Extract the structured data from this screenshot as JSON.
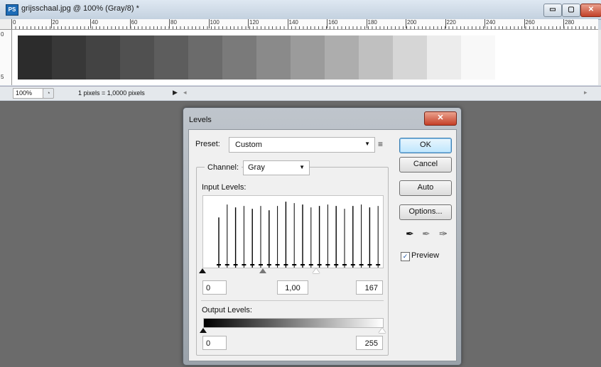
{
  "document": {
    "app_icon": "PS",
    "title": "grijsschaal.jpg @ 100% (Gray/8) *",
    "window_buttons": {
      "minimize": "▭",
      "maximize": "▢",
      "close": "✕"
    },
    "ruler_h_labels": [
      "0",
      "20",
      "40",
      "60",
      "80",
      "100",
      "120",
      "140",
      "160",
      "180",
      "200",
      "220",
      "240",
      "260",
      "280"
    ],
    "ruler_v_labels": [
      "0",
      "5"
    ],
    "swatch_colors": [
      "#2c2c2c",
      "#383838",
      "#434343",
      "#505050",
      "#5d5d5d",
      "#6b6b6b",
      "#7a7a7a",
      "#8a8a8a",
      "#9b9b9b",
      "#adadad",
      "#c0c0c0",
      "#d6d6d6",
      "#ececec",
      "#f8f8f8",
      "#ffffff",
      "#ffffff"
    ],
    "status": {
      "zoom": "100%",
      "icon": "◔",
      "info": "1 pixels = 1,0000 pixels",
      "arrow": "▶",
      "scroll_left": "◂",
      "scroll_right": "▸"
    }
  },
  "levels": {
    "title": "Levels",
    "close_label": "✕",
    "preset_label": "Preset:",
    "preset_value": "Custom",
    "preset_menu_icon": "≡",
    "channel_label": "Channel:",
    "channel_value": "Gray",
    "input_levels_label": "Input Levels:",
    "input_black": "0",
    "input_gamma": "1,00",
    "input_white": "167",
    "output_levels_label": "Output Levels:",
    "output_black": "0",
    "output_white": "255",
    "buttons": {
      "ok": "OK",
      "cancel": "Cancel",
      "auto": "Auto",
      "options": "Options..."
    },
    "preview_label": "Preview",
    "preview_checked": "✓",
    "histogram_peaks": [
      0.7,
      0.88,
      0.84,
      0.86,
      0.82,
      0.86,
      0.8,
      0.86,
      0.92,
      0.9,
      0.88,
      0.84,
      0.86,
      0.88,
      0.86,
      0.82,
      0.86,
      0.88,
      0.84,
      0.86
    ],
    "icons": {
      "black_dropper": "✒",
      "gray_dropper": "✒",
      "white_dropper": "✒"
    }
  }
}
